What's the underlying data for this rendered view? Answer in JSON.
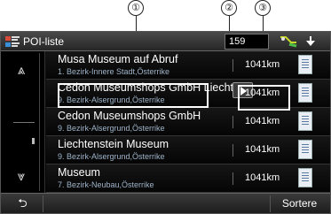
{
  "callouts": [
    "①",
    "②",
    "③"
  ],
  "header": {
    "title": "POI-liste",
    "count": "159",
    "icons": {
      "title": "poi-list-icon",
      "gps": "gps-signal-icon",
      "arrow": "download-arrow-icon"
    }
  },
  "sidebar": {
    "up_icon": "scroll-up-icon",
    "down_icon": "scroll-down-icon",
    "up_glyph": "⩓",
    "down_glyph": "⩔"
  },
  "list": [
    {
      "name": "Musa Museum auf Abruf",
      "address": "1. Bezirk-Innere Stadt,Österrike",
      "distance": "1041km"
    },
    {
      "name": "Cedon Museumshops GmbH Liechtenstein",
      "address": "9. Bezirk-Alsergrund,Österrike",
      "distance": "1041km"
    },
    {
      "name": "Cedon Museumshops GmbH",
      "address": "9. Bezirk-Alsergrund,Österrike",
      "distance": "1041km"
    },
    {
      "name": "Liechtenstein Museum",
      "address": "9. Bezirk-Alsergrund,Österrike",
      "distance": "1041km"
    },
    {
      "name": "Museum",
      "address": "7. Bezirk-Neubau,Österrike",
      "distance": "1041km"
    }
  ],
  "footer": {
    "back_glyph": "⮌",
    "sort_label": "Sortere"
  }
}
